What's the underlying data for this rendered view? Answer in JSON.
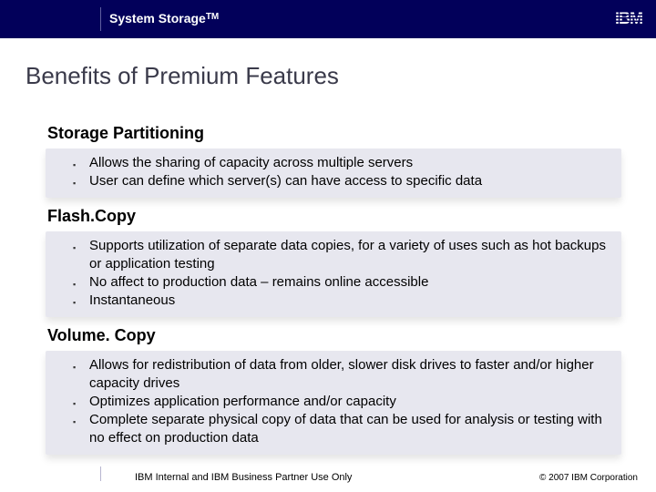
{
  "banner": {
    "title": "System Storage",
    "trademark": "TM",
    "logo_text": "IBM"
  },
  "title": "Benefits of Premium Features",
  "sections": [
    {
      "heading": "Storage Partitioning",
      "bullets": [
        "Allows the sharing of capacity across multiple servers",
        "User can define which server(s) can have access to specific data"
      ]
    },
    {
      "heading": "Flash.Copy",
      "bullets": [
        "Supports utilization of separate data copies, for a variety of uses such as hot backups or application testing",
        "No affect to production data – remains online accessible",
        "Instantaneous"
      ]
    },
    {
      "heading": "Volume. Copy",
      "bullets": [
        "Allows for redistribution of data from older, slower disk drives to faster and/or higher capacity drives",
        "Optimizes application performance and/or capacity",
        "Complete separate physical copy of data that can be used for analysis or testing with no effect on production data"
      ]
    }
  ],
  "footer": {
    "note": "IBM Internal and IBM Business Partner Use Only",
    "copyright": "© 2007 IBM Corporation"
  }
}
